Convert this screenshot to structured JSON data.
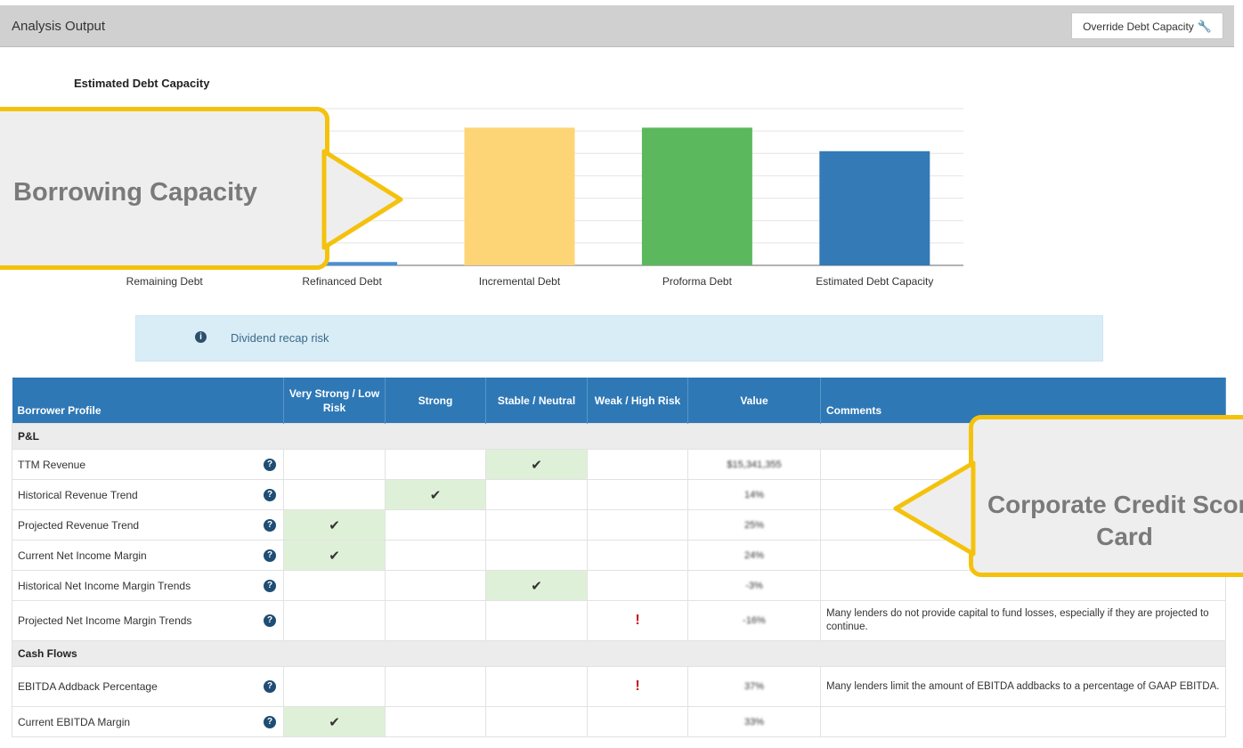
{
  "panel": {
    "title": "Analysis Output",
    "override_button_label": "Override Debt Capacity",
    "override_icon": "wrench-icon"
  },
  "chart_data": {
    "type": "bar",
    "title": "Estimated Debt Capacity",
    "categories": [
      "Remaining Debt",
      "Refinanced Debt",
      "Incremental Debt",
      "Proforma Debt",
      "Estimated Debt Capacity"
    ],
    "values": [
      0,
      0.3,
      12.3,
      12.3,
      10.2
    ],
    "colors": [
      "#f5a623",
      "#4a90d9",
      "#fdd576",
      "#5cb85c",
      "#337ab7"
    ],
    "ylim": [
      0,
      14
    ],
    "grid": true,
    "legend": "none"
  },
  "alert": {
    "icon": "info-icon",
    "text": "Dividend recap risk"
  },
  "table": {
    "headers": [
      "Borrower Profile",
      "Very Strong / Low Risk",
      "Strong",
      "Stable / Neutral",
      "Weak / High Risk",
      "Value",
      "Comments"
    ],
    "sections": [
      {
        "title": "P&L",
        "rows": [
          {
            "label": "TTM Revenue",
            "rating": "Stable / Neutral",
            "value": "$15,341,355",
            "comment": ""
          },
          {
            "label": "Historical Revenue Trend",
            "rating": "Strong",
            "value": "14%",
            "comment": ""
          },
          {
            "label": "Projected Revenue Trend",
            "rating": "Very Strong / Low Risk",
            "value": "25%",
            "comment": ""
          },
          {
            "label": "Current Net Income Margin",
            "rating": "Very Strong / Low Risk",
            "value": "24%",
            "comment": ""
          },
          {
            "label": "Historical Net Income Margin Trends",
            "rating": "Stable / Neutral",
            "value": "-3%",
            "comment": ""
          },
          {
            "label": "Projected Net Income Margin Trends",
            "rating": "Weak / High Risk",
            "value": "-16%",
            "comment": "Many lenders do not provide capital to fund losses, especially if they are projected to continue."
          }
        ]
      },
      {
        "title": "Cash Flows",
        "rows": [
          {
            "label": "EBITDA Addback Percentage",
            "rating": "Weak / High Risk",
            "value": "37%",
            "comment": "Many lenders limit the amount of EBITDA addbacks to a percentage of GAAP EBITDA."
          },
          {
            "label": "Current EBITDA Margin",
            "rating": "Very Strong / Low Risk",
            "value": "33%",
            "comment": ""
          }
        ]
      }
    ],
    "check_symbol": "✔",
    "warn_symbol": "!"
  },
  "callouts": {
    "borrowing": "Borrowing Capacity",
    "credit": "Corporate Credit Score Card"
  }
}
